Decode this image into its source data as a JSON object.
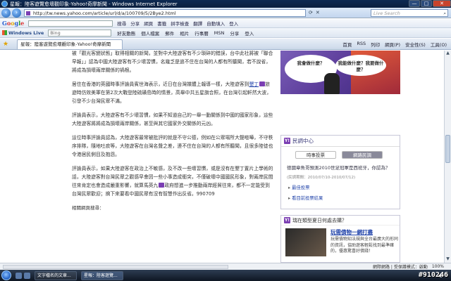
{
  "window": {
    "title": "星報：陸客遊覽愈壞觀印象-Yahoo!奇摩新聞 - Windows Internet Explorer",
    "controls": [
      "—",
      "□",
      "✕"
    ]
  },
  "address_bar": {
    "url": "http://tw.news.yahoo.com/article/url/d/a/100709/5/2Bye2.html",
    "search_placeholder": "Live Search"
  },
  "google_toolbar": {
    "logo_letters": [
      "G",
      "o",
      "o",
      "g",
      "l",
      "e"
    ],
    "items": [
      "搜尋",
      "分享",
      "網頁",
      "書籤",
      "拼字檢查",
      "翻譯",
      "自動填入",
      "登入"
    ]
  },
  "live_toolbar": {
    "brand": "Windows Live",
    "search_value": "Bing",
    "items": [
      "好友動態",
      "個人檔案",
      "郵件",
      "相片",
      "行事曆",
      "MSN",
      "分享",
      "登入"
    ]
  },
  "tab_bar": {
    "tab_title": "星報：陸客遊覽愈壞觀印象-Yahoo!奇摩新聞",
    "tools": [
      "首頁",
      "RSS",
      "列印",
      "網頁(P)",
      "安全性(S)",
      "工具(O)"
    ]
  },
  "article": {
    "p0": "被「觀光客變狀態」取得相關的新聞，並對中大陸遊客有不少瑣碎的錯誤，台中此社將被「聯合早報」」認為中國大陸遊客有不少壞習慣，名幾乏是過不住在台灣的人都有所聽聞，若不說省，將成為損壞兩岸關係的禍根。",
    "p1a": "居住在香港的英國時事評論員賓世海表示，近日在台灣媒體上報導一樣，大陸遊客到",
    "p1_link": "墾丁",
    "p1b": "旅遊時仿效美軍在第2次大戰登陸硫磺島時的情景，高舉中共五星旗合照，在台灣引起軒然大波，引發不少台灣民眾不滿。",
    "p2": "評論員表示，大陸遊客有不少壞習慣，如果不知道自己的一舉一動關係到中國的國家形象，這些大陸遊客將將成為損壞兩岸關係，甚至與其它國家外交關係的元凶。",
    "p3": "這位時事評論員認為，大陸遊客最常被批評的就是不守公德，例如在公眾場所大聲喧嘩，不守秩序排隊，隨地吐痰等，大陸遊客在台灣名聲之差，連不住在台灣的人都有所聽聞，且很多陸徒也令港居民側目及抱怨。",
    "p4a": "評論員表示，如果大陸遊客在政治上不敏感，及不改一些壞習慣，或是沒有在墾丁置片上學術的話，大陸遊客對台灣民眾之觀感早會因一些小事造成衝突，不僅破壞中國國民形象，對兩岸民間往來肯定也會造成嚴重影響，就算馬英九",
    "p4b": "政府想進一步推動兩岸經貿往來，都不一定能受到台灣民眾歡迎；搞下來要看中國民眾有沒有智慧作出反省。990709",
    "editor_label": "相關網頁搜尋："
  },
  "ad": {
    "bubble_left": "我會做什麼？",
    "bubble_right": "我能做什麼？我要做什麼？"
  },
  "poll": {
    "icon_letter": "Y!",
    "title": "民調中心",
    "tabs": [
      "時事投票",
      "網路民調"
    ],
    "question": "德國章魚哥預測2010世足冠軍是西班牙，你認為？",
    "meta": "(民調期間：2010/07/10-2010/07/12)",
    "links": [
      "最佳投票",
      "看目前投票結果"
    ]
  },
  "promo": {
    "heading": "瑞在類型夏日何處去購？",
    "title": "玩需債物一網打盡",
    "description": "玩需債物知法規與全台最廣大的形同的資訊，協助遊客輕鬆找到最準確的，優惠驚喜好價錢！"
  },
  "status_bar": {
    "zone": "網際網路 | 受保護模式：啟動",
    "zoom": "100%"
  },
  "taskbar": {
    "items": [
      "文字檔名的文章...",
      "星報：陸客遊覽..."
    ],
    "stamp": "#910246"
  }
}
